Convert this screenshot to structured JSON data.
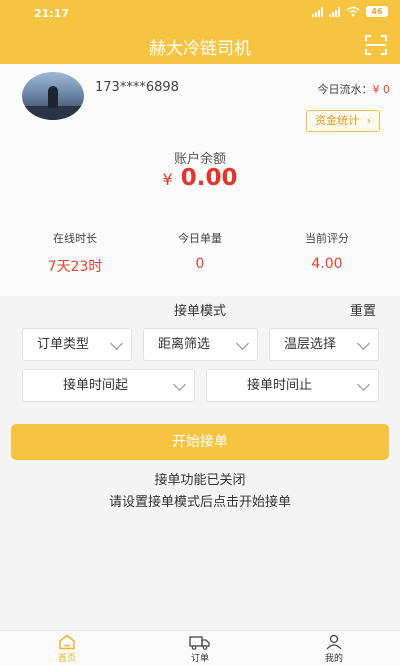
{
  "status_bar": {
    "time": "21:17",
    "battery": "46"
  },
  "app": {
    "title": "赫大冷链司机"
  },
  "profile": {
    "phone": "173****6898",
    "flow_label": "今日流水：",
    "flow_value": "¥ 0",
    "stats_button": "资金统计"
  },
  "balance": {
    "label": "账户余额",
    "currency": "¥",
    "value": "0.00"
  },
  "metrics": [
    {
      "label": "在线时长",
      "value": "7天23时"
    },
    {
      "label": "今日单量",
      "value": "0"
    },
    {
      "label": "当前评分",
      "value": "4.00"
    }
  ],
  "mode": {
    "title": "接单模式",
    "reset": "重置",
    "filters": [
      "订单类型",
      "距离筛选",
      "温层选择",
      "接单时间起",
      "接单时间止"
    ]
  },
  "start_button": "开始接单",
  "status_lines": [
    "接单功能已关闭",
    "请设置接单模式后点击开始接单"
  ],
  "tabs": [
    {
      "label": "首页",
      "icon": "home-icon"
    },
    {
      "label": "订单",
      "icon": "truck-icon"
    },
    {
      "label": "我的",
      "icon": "user-icon"
    }
  ],
  "colors": {
    "accent": "#f7c442",
    "money": "#e3352a"
  }
}
